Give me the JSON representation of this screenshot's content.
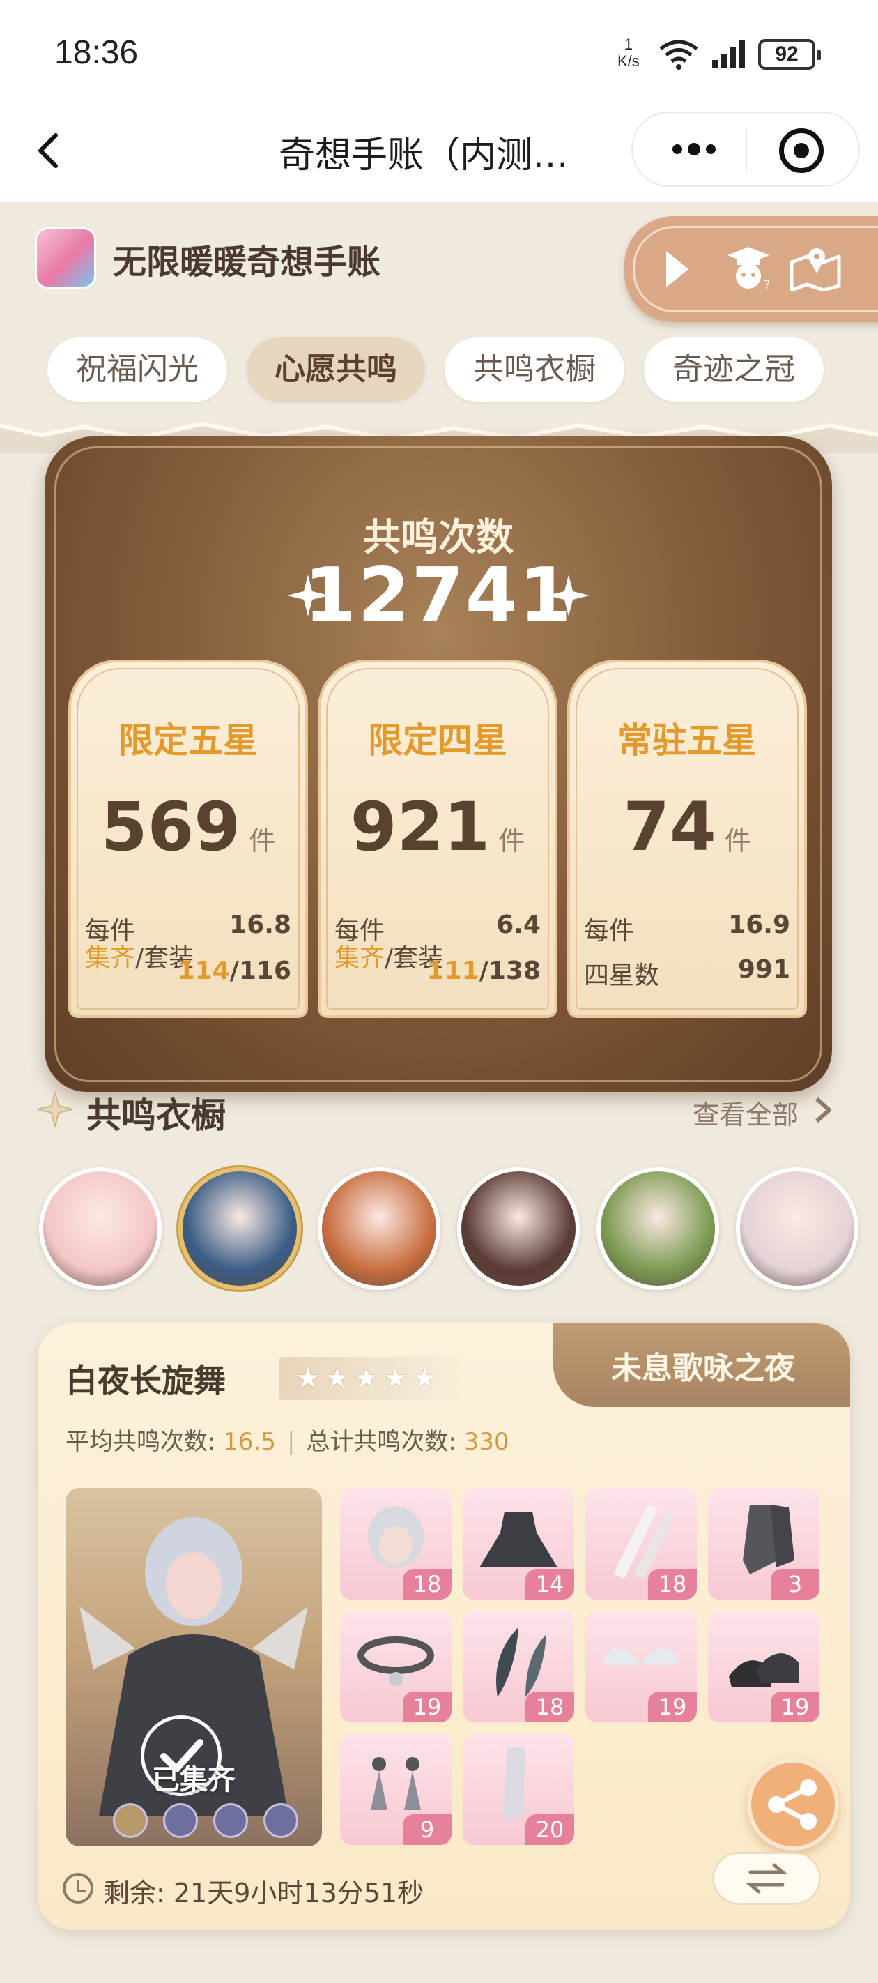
{
  "status_bar": {
    "time": "18:36",
    "net_value": "1",
    "net_unit": "K/s",
    "battery": "92"
  },
  "nav": {
    "title": "奇想手账（内测…"
  },
  "app": {
    "name": "无限暖暖奇想手账"
  },
  "tabs": [
    "祝福闪光",
    "心愿共鸣",
    "共鸣衣橱",
    "奇迹之冠"
  ],
  "active_tab": 1,
  "resonance": {
    "label": "共鸣次数",
    "total": "12741",
    "cards": [
      {
        "title": "限定五星",
        "value": "569",
        "unit": "件",
        "row1_label": "每件",
        "row1_value": "16.8",
        "row2_hl": "集齐",
        "row2_label": "/套装",
        "row2_num": "114",
        "row2_den": "/116"
      },
      {
        "title": "限定四星",
        "value": "921",
        "unit": "件",
        "row1_label": "每件",
        "row1_value": "6.4",
        "row2_hl": "集齐",
        "row2_label": "/套装",
        "row2_num": "111",
        "row2_den": "/138"
      },
      {
        "title": "常驻五星",
        "value": "74",
        "unit": "件",
        "row1_label": "每件",
        "row1_value": "16.9",
        "row2_label": "四星数",
        "row2_value": "991"
      }
    ]
  },
  "wardrobe": {
    "title": "共鸣衣橱",
    "view_all": "查看全部",
    "avatar_colors": [
      "#f3c6c8",
      "#3a5d86",
      "#c86d3e",
      "#5b3b36",
      "#7c9a52",
      "#e4d2d6"
    ],
    "selected_avatar": 1
  },
  "suit": {
    "name": "白夜长旋舞",
    "stars": "★★★★★",
    "banner": "未息歌咏之夜",
    "avg_label": "平均共鸣次数: ",
    "avg_value": "16.5",
    "total_label": "总计共鸣次数: ",
    "total_value": "330",
    "status": "已集齐",
    "items": [
      "18",
      "14",
      "18",
      "3",
      "19",
      "18",
      "19",
      "19",
      "9",
      "20"
    ],
    "timer": "剩余: 21天9小时13分51秒"
  }
}
